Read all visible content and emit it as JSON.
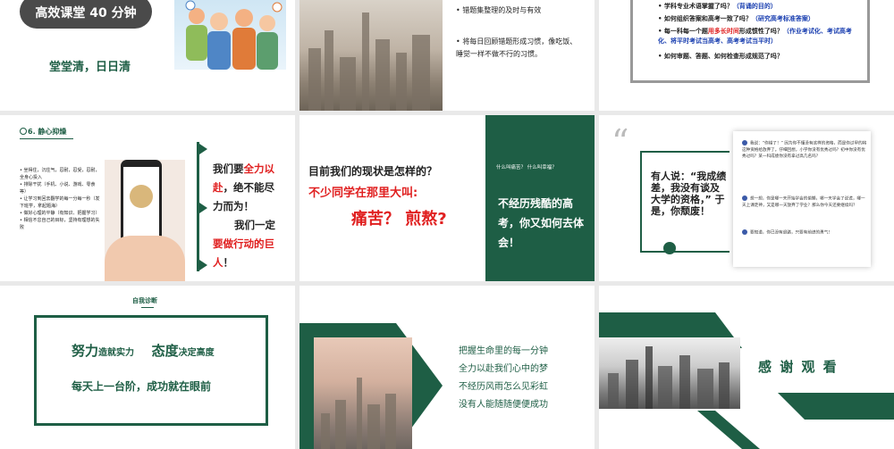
{
  "colors": {
    "accent_green": "#1e5e45",
    "red": "#e02020",
    "blue": "#1a3fb0",
    "background": "#e9e9e9"
  },
  "s1": {
    "pill": "高效课堂 40 分钟",
    "subtitle": "堂堂清，日日清"
  },
  "s3": {
    "bullets": [
      "错题集整理的及时与有效",
      "将每日回顾错题形成习惯，像吃饭、睡觉一样不做不行的习惯。"
    ]
  },
  "s4": {
    "items": [
      {
        "a": "学科专业术语掌握了吗？",
        "b": "（背诵的目的）"
      },
      {
        "a": "如何组织答案和高考一致了吗？",
        "b": "（研究高考标准答案）"
      },
      {
        "a": "每一科每一个题",
        "r": "用多长时间",
        "c": "形成惯性了吗？",
        "b": "（作业考试化、考试高考化、将平时考试当高考、高考考试当平时）"
      },
      {
        "a": "如何审题、答题、如何检查形成规范了吗？"
      }
    ]
  },
  "s5": {
    "heading": "6. 静心抑燥",
    "bullets": [
      "坐得住，沉住气，忍耐，忍受，忍耐，全身心投入",
      "排除干扰（手机、小说、游戏、零食等）",
      "让学习到回去翻学的每一分每一秒（发下班学，拿起题海）",
      "做好心理的平静（有知识、把握学习）",
      "相信不怠自己的目标，坚持有理想的失败"
    ],
    "quote_l1_a": "我们要",
    "quote_l1_b": "全力以",
    "quote_l2_a": "赴",
    "quote_l2_b": "，绝不能尽",
    "quote_l3": "力而为！",
    "quote_l4": "我们一定",
    "quote_l5_a": "要做行动的巨",
    "quote_l6_a": "人",
    "quote_l6_b": "！"
  },
  "s6": {
    "q1": "目前我们的现状是怎样的？",
    "q2": "不少同学在那里大叫:",
    "q3": "痛苦？ 煎熬?",
    "panel_top": "什么叫痛苦？   什么叫幸福？",
    "panel_main": "不经历残酷的高考，你又如何去体会！"
  },
  "s7": {
    "quote_mark": "“",
    "box_text": "有人说：“我成绩差，我没有谈及大学的资格，” 于是，你颓废！",
    "cards": [
      "我说：“你错了！” 因为你不懂没有这样的资格，而是你过早的将这种资格给放弃了。仔细回想，小学你没有优秀过吗？初中你没有优秀过吗？某一科成绩你没有拿过高几名吗？",
      "想一想，你是哪一天开始学会的偷懒，哪一天学会了说谎，哪一天上课走神，又是哪一天放弃了学业？那么你今天还要继续吗？",
      "要知道，你已没有退路，只要有前进的勇气！"
    ]
  },
  "s8": {
    "title": "自我诊断",
    "line1_a": "努力",
    "line1_b": "造就实力",
    "line1_c": "态度",
    "line1_d": "决定高度",
    "line2": "每天上一台阶，成功就在眼前"
  },
  "s9": {
    "lines": [
      "把握生命里的每一分钟",
      "全力以赴我们心中的梦",
      "不经历风雨怎么见彩虹",
      "没有人能随随便便成功"
    ]
  },
  "s10": {
    "thanks": "感 谢 观 看"
  }
}
